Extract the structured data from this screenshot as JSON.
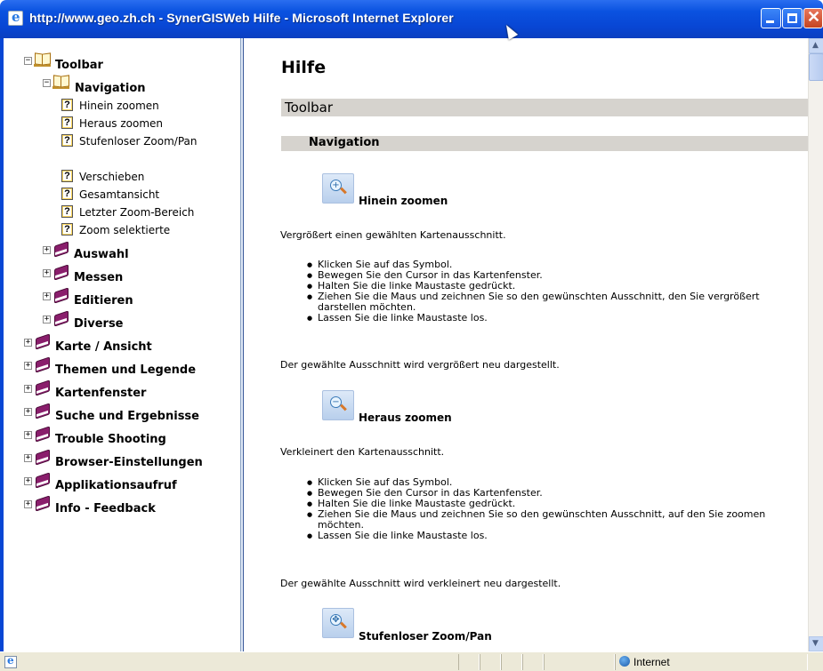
{
  "window": {
    "title": "http://www.geo.zh.ch - SynerGISWeb Hilfe - Microsoft Internet Explorer"
  },
  "nav_tree": {
    "toolbar": {
      "label": "Toolbar",
      "toggle": "−",
      "icon": "book-open-icon"
    },
    "navigation": {
      "label": "Navigation",
      "toggle": "−",
      "icon": "book-open-icon"
    },
    "navigation_items": [
      "Hinein zoomen",
      "Heraus zoomen",
      "Stufenloser Zoom/Pan",
      "Verschieben",
      "Gesamtansicht",
      "Letzter Zoom-Bereich",
      "Zoom selektierte"
    ],
    "toolbar_subgroups": [
      "Auswahl",
      "Messen",
      "Editieren",
      "Diverse"
    ],
    "top_groups": [
      "Karte / Ansicht",
      "Themen und Legende",
      "Kartenfenster",
      "Suche und Ergebnisse",
      "Trouble Shooting",
      "Browser-Einstellungen",
      "Applikationsaufruf",
      "Info - Feedback"
    ],
    "expand_symbol": "+",
    "help_symbol": "?"
  },
  "content": {
    "page_title": "Hilfe",
    "section_title": "Toolbar",
    "subsection_title": "Navigation",
    "zoom_in": {
      "heading": "Hinein zoomen",
      "icon_symbol": "+",
      "intro": "Vergrößert einen gewählten Kartenausschnitt.",
      "steps": [
        "Klicken Sie auf das Symbol.",
        "Bewegen Sie den Cursor in das Kartenfenster.",
        "Halten Sie die linke Maustaste gedrückt.",
        "Ziehen Sie die Maus und zeichnen Sie so den gewünschten Ausschnitt, den Sie vergrößert darstellen möchten.",
        "Lassen Sie die linke Maustaste los."
      ],
      "result": "Der gewählte Ausschnitt wird vergrößert neu dargestellt."
    },
    "zoom_out": {
      "heading": "Heraus zoomen",
      "icon_symbol": "−",
      "intro": "Verkleinert den Kartenausschnitt.",
      "steps": [
        "Klicken Sie auf das Symbol.",
        "Bewegen Sie den Cursor in das Kartenfenster.",
        "Halten Sie die linke Maustaste gedrückt.",
        "Ziehen Sie die Maus und zeichnen Sie so den gewünschten Ausschnitt, auf den Sie zoomen möchten.",
        "Lassen Sie die linke Maustaste los."
      ],
      "result": "Der gewählte Ausschnitt wird verkleinert neu dargestellt."
    },
    "zoom_pan": {
      "heading": "Stufenloser Zoom/Pan",
      "icon_symbol": "✥"
    }
  },
  "statusbar": {
    "zone": "Internet"
  },
  "colors": {
    "titlebar": "#0846d4",
    "section_bar": "#d6d3ce",
    "book_closed": "#8a1e6c"
  }
}
